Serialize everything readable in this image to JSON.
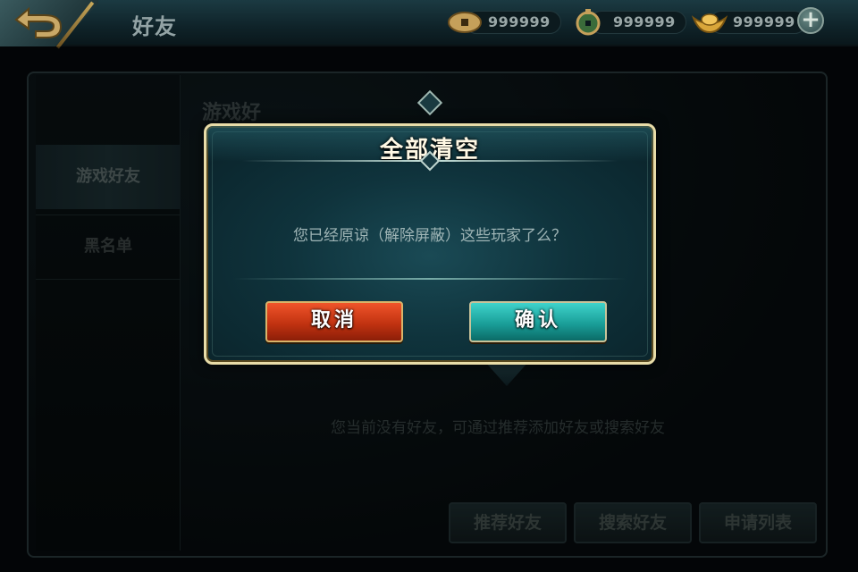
{
  "header": {
    "title": "好友",
    "currencies": [
      {
        "icon": "copper-coin-icon",
        "amount": "999999"
      },
      {
        "icon": "jade-coin-icon",
        "amount": "999999"
      },
      {
        "icon": "gold-ingot-icon",
        "amount": "999999"
      }
    ]
  },
  "sidebar": {
    "items": [
      {
        "label": "游戏好友",
        "active": true
      },
      {
        "label": "黑名单",
        "active": false
      }
    ]
  },
  "main": {
    "section_title": "游戏好",
    "empty_message": "您当前没有好友，可通过推荐添加好友或搜索好友",
    "buttons": {
      "recommend": "推荐好友",
      "search": "搜索好友",
      "requests": "申请列表"
    }
  },
  "dialog": {
    "title": "全部清空",
    "message": "您已经原谅（解除屏蔽）这些玩家了么？",
    "cancel_label": "取消",
    "confirm_label": "确认"
  },
  "colors": {
    "cancel_button": "#c23311",
    "confirm_button": "#1a9f99",
    "dialog_border": "#e8dca8",
    "dialog_bg": "#0f333c"
  }
}
